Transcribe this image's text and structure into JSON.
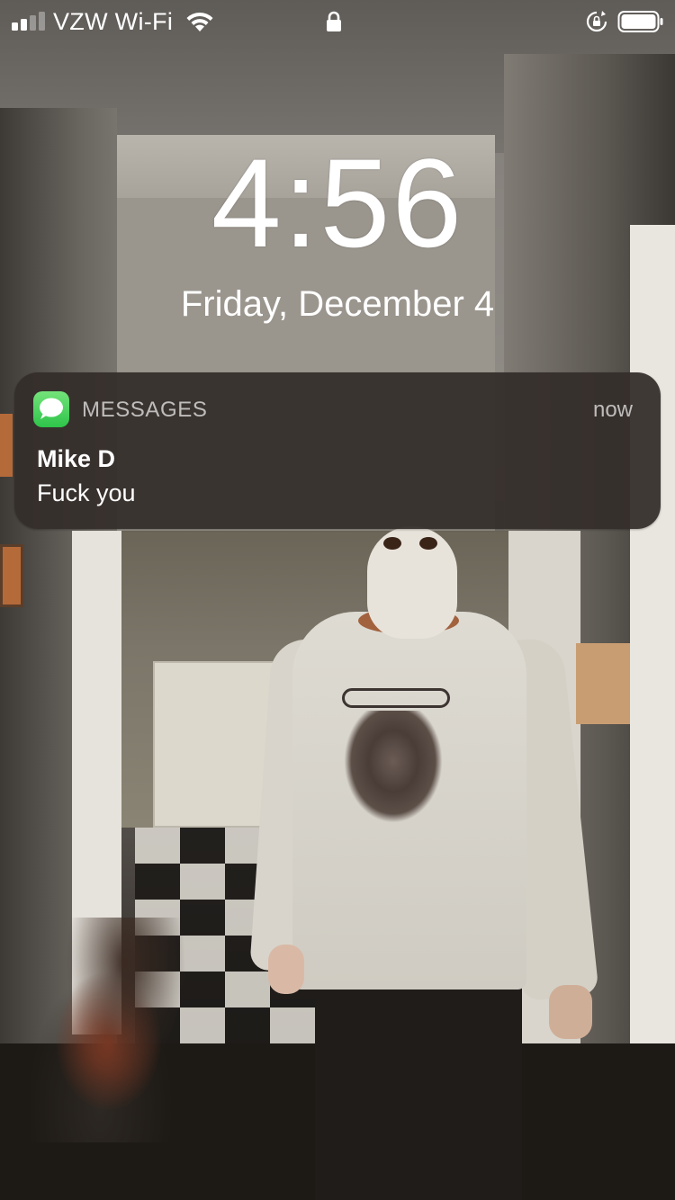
{
  "status_bar": {
    "signal_bars_filled": 2,
    "signal_bars_total": 4,
    "carrier": "VZW Wi-Fi",
    "icons": [
      "signal-bars-icon",
      "wifi-icon",
      "lock-icon",
      "rotation-lock-icon",
      "battery-icon"
    ],
    "battery_level": 1.0
  },
  "lock_screen": {
    "time": "4:56",
    "date": "Friday, December 4"
  },
  "notification": {
    "app_icon": "messages-app-icon",
    "app_name": "MESSAGES",
    "time": "now",
    "sender": "Mike D",
    "message": "Fuck you",
    "accent_color": "#34c759"
  },
  "wallpaper": {
    "kind": "photo"
  }
}
